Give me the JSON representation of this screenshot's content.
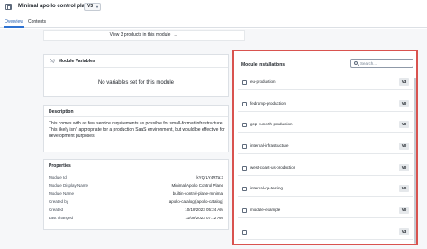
{
  "header": {
    "title": "Minimal apollo control plane",
    "version": "V3"
  },
  "tabs": [
    {
      "label": "Overview",
      "active": true
    },
    {
      "label": "Contents",
      "active": false
    }
  ],
  "products_link": "View 3 products in this module",
  "variables": {
    "icon": "variable-icon",
    "title": "Module Variables",
    "empty_text": "No variables set for this module"
  },
  "description": {
    "title": "Description",
    "paragraphs": [
      "This comes with as few service requirements as possible for small-format infrastructure.",
      "This likely isn't appropriate for a production SaaS environment, but would be effective for development purposes."
    ]
  },
  "properties": {
    "title": "Properties",
    "rows": [
      {
        "key": "Module Id",
        "value": "kYQrLY4RTa:3"
      },
      {
        "key": "Module Display Name",
        "value": "Minimal Apollo Control Plane"
      },
      {
        "key": "Module Name",
        "value": "builtin-control-plane-minimal"
      },
      {
        "key": "Created by",
        "value": "apollo-catalog (apollo-catalog)"
      },
      {
        "key": "Created",
        "value": "10/18/2023 05:24 AM"
      },
      {
        "key": "Last changed",
        "value": "11/08/2023 07:12 AM"
      }
    ]
  },
  "installations": {
    "title": "Module Installations",
    "search_placeholder": "Search...",
    "items": [
      {
        "name": "eu-production",
        "version": "V3"
      },
      {
        "name": "fedramp-production",
        "version": "V0"
      },
      {
        "name": "gcp-eunorth-production",
        "version": "V0"
      },
      {
        "name": "internal-infrastructure",
        "version": "V0"
      },
      {
        "name": "west-coast-us-production",
        "version": "V0"
      },
      {
        "name": "internal-qa-testing",
        "version": "V0"
      },
      {
        "name": "module-example",
        "version": "V0"
      },
      {
        "name": "",
        "version": "V3"
      }
    ]
  },
  "colors": {
    "accent": "#2d72d2",
    "highlight_border": "#d9534f"
  }
}
